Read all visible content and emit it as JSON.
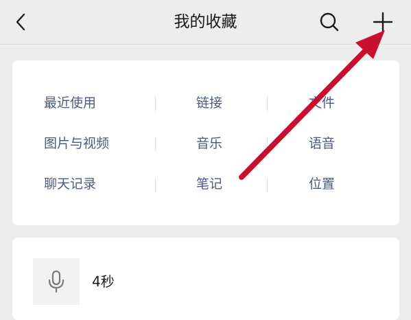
{
  "header": {
    "title": "我的收藏",
    "back_icon": "chevron-left-icon",
    "search_icon": "search-icon",
    "add_icon": "plus-icon"
  },
  "categories": {
    "rows": [
      [
        "最近使用",
        "链接",
        "文件"
      ],
      [
        "图片与视频",
        "音乐",
        "语音"
      ],
      [
        "聊天记录",
        "笔记",
        "位置"
      ]
    ]
  },
  "favorites": {
    "items": [
      {
        "type_icon": "microphone-icon",
        "title": "4秒"
      }
    ]
  },
  "colors": {
    "background": "#ededed",
    "card": "#ffffff",
    "category_text": "#4c5b7a",
    "annotation_arrow": "#c8102e"
  }
}
